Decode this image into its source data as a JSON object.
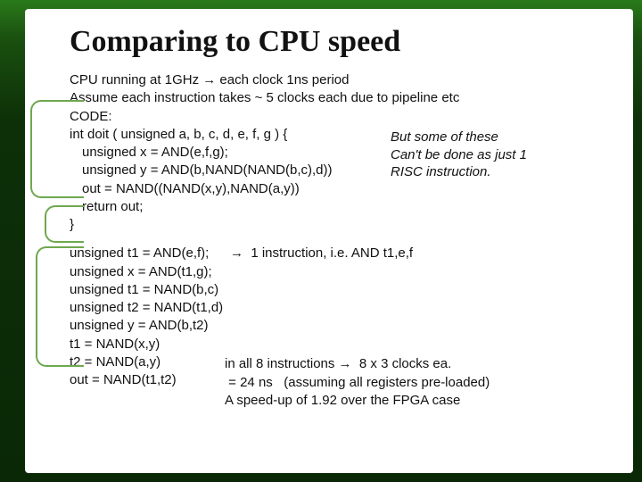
{
  "title": "Comparing to CPU speed",
  "block1": {
    "l1": "CPU running at 1GHz → each clock 1ns period",
    "l2": "Assume each instruction takes ~ 5 clocks each due to pipeline etc",
    "l3": "CODE:",
    "l4": "int doit ( unsigned a, b, c, d, e, f, g ) {",
    "l5": "unsigned x = AND(e,f,g);",
    "l6": "unsigned y = AND(b,NAND(NAND(b,c),d))",
    "l7": "out = NAND((NAND(x,y),NAND(a,y))",
    "l8": "return out;",
    "l9": "}"
  },
  "note": {
    "n1": "But some of these",
    "n2": "Can't be done as just 1",
    "n3": "RISC instruction."
  },
  "block2": {
    "l1": "unsigned t1 = AND(e,f);",
    "l2": "unsigned x = AND(t1,g);",
    "l3": "unsigned t1 = NAND(b,c)",
    "l4": "unsigned t2 = NAND(t1,d)",
    "l5": "unsigned y = AND(b,t2)",
    "l6": "t1 = NAND(x,y)",
    "l7": "t2 = NAND(a,y)",
    "l8": "out = NAND(t1,t2)"
  },
  "annot1": "→  1 instruction, i.e. AND t1,e,f",
  "bnotes": {
    "b1": "in all 8 instructions →  8 x 3 clocks ea.",
    "b2": " = 24 ns   (assuming all registers pre-loaded)",
    "b3": "A speed-up of 1.92 over the FPGA case"
  }
}
